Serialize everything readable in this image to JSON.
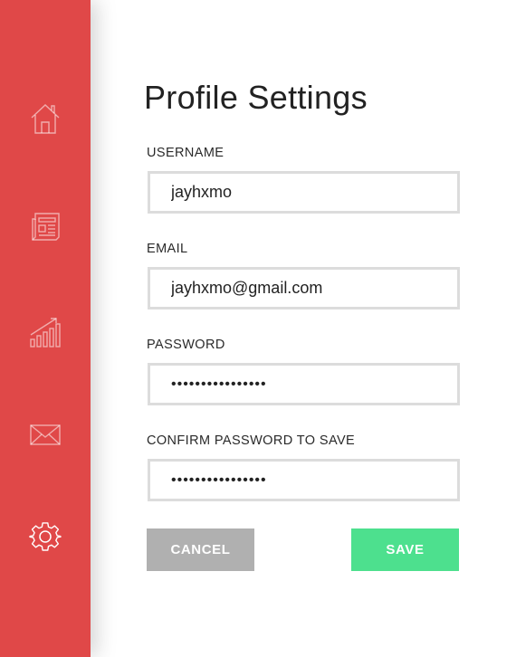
{
  "sidebar": {
    "accent_color": "#e04848",
    "items": [
      {
        "name": "home",
        "icon": "home-icon"
      },
      {
        "name": "news",
        "icon": "newspaper-icon"
      },
      {
        "name": "stats",
        "icon": "bar-chart-icon"
      },
      {
        "name": "messages",
        "icon": "envelope-icon"
      },
      {
        "name": "settings",
        "icon": "gear-icon"
      }
    ]
  },
  "page": {
    "title": "Profile Settings"
  },
  "form": {
    "username": {
      "label": "USERNAME",
      "value": "jayhxmo"
    },
    "email": {
      "label": "EMAIL",
      "value": "jayhxmo@gmail.com"
    },
    "password": {
      "label": "PASSWORD",
      "value": "••••••••••••••••"
    },
    "confirm_password": {
      "label": "CONFIRM PASSWORD TO SAVE",
      "value": "••••••••••••••••"
    }
  },
  "actions": {
    "cancel_label": "CANCEL",
    "save_label": "SAVE",
    "cancel_color": "#b0b0b0",
    "save_color": "#4de08e"
  }
}
